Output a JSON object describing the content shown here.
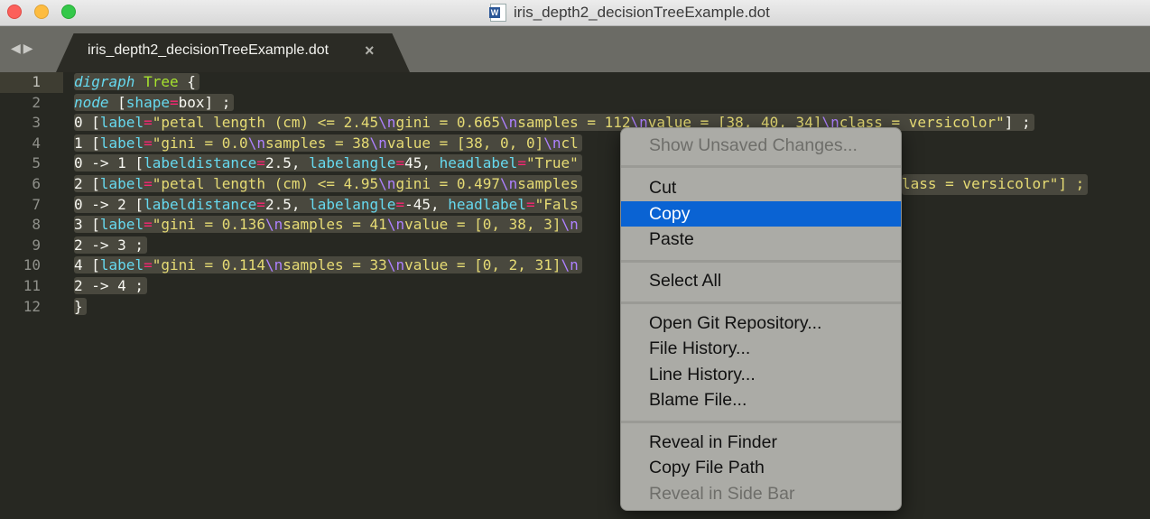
{
  "window": {
    "title": "iris_depth2_decisionTreeExample.dot",
    "title_icon": "word-document-icon"
  },
  "tabbar": {
    "back_icon": "◀",
    "forward_icon": "▶",
    "tabs": [
      {
        "label": "iris_depth2_decisionTreeExample.dot",
        "close_icon": "×",
        "active": true
      }
    ]
  },
  "editor": {
    "line_numbers": [
      "1",
      "2",
      "3",
      "4",
      "5",
      "6",
      "7",
      "8",
      "9",
      "10",
      "11",
      "12"
    ],
    "current_line": 1,
    "lines": [
      "digraph Tree {",
      "node [shape=box] ;",
      "0 [label=\"petal length (cm) <= 2.45\\ngini = 0.665\\nsamples = 112\\nvalue = [38, 40, 34]\\nclass = versicolor\"] ;",
      "1 [label=\"gini = 0.0\\nsamples = 38\\nvalue = [38, 0, 0]\\ncl",
      "0 -> 1 [labeldistance=2.5, labelangle=45, headlabel=\"True\"",
      "2 [label=\"petal length (cm) <= 4.95\\ngini = 0.497\\nsamples",
      "0 -> 2 [labeldistance=2.5, labelangle=-45, headlabel=\"Fals",
      "3 [label=\"gini = 0.136\\nsamples = 41\\nvalue = [0, 38, 3]\\n",
      "2 -> 3 ;",
      "4 [label=\"gini = 0.114\\nsamples = 33\\nvalue = [0, 2, 31]\\n",
      "2 -> 4 ;",
      "}"
    ],
    "line6_tail": "lass = versicolor\"] ;"
  },
  "context_menu": {
    "items": [
      {
        "label": "Show Unsaved Changes...",
        "disabled": true
      },
      {
        "label": "Cut"
      },
      {
        "label": "Copy",
        "highlighted": true
      },
      {
        "label": "Paste"
      },
      {
        "label": "Select All"
      },
      {
        "label": "Open Git Repository..."
      },
      {
        "label": "File History..."
      },
      {
        "label": "Line History..."
      },
      {
        "label": "Blame File..."
      },
      {
        "label": "Reveal in Finder"
      },
      {
        "label": "Copy File Path"
      },
      {
        "label": "Reveal in Side Bar",
        "disabled": true
      }
    ],
    "highlight_color": "#0a63d3"
  },
  "theme": {
    "background": "#272822",
    "selection": "#49483e",
    "keyword": "#66d9ef",
    "string": "#e6db74",
    "operator": "#f92672",
    "escape": "#ae81ff",
    "class": "#a6e22e"
  }
}
